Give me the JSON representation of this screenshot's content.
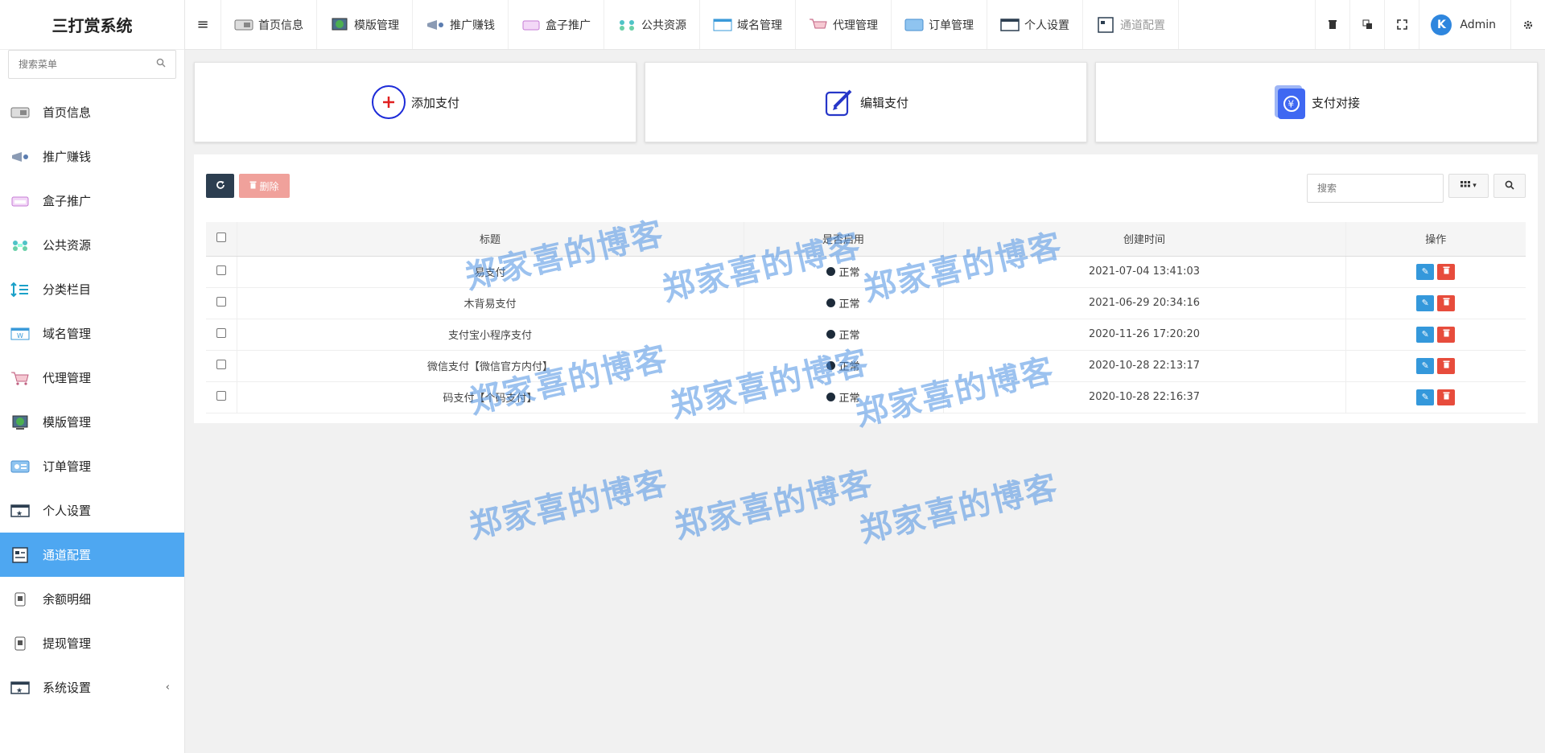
{
  "brand": "三打赏系统",
  "sidebar": {
    "search_placeholder": "搜索菜单",
    "items": [
      {
        "label": "首页信息",
        "icon": "home-card-icon"
      },
      {
        "label": "推广赚钱",
        "icon": "megaphone-icon"
      },
      {
        "label": "盒子推广",
        "icon": "box-icon"
      },
      {
        "label": "公共资源",
        "icon": "resource-icon"
      },
      {
        "label": "分类栏目",
        "icon": "sort-icon"
      },
      {
        "label": "域名管理",
        "icon": "domain-icon"
      },
      {
        "label": "代理管理",
        "icon": "cart-icon"
      },
      {
        "label": "模版管理",
        "icon": "template-icon"
      },
      {
        "label": "订单管理",
        "icon": "order-icon"
      },
      {
        "label": "个人设置",
        "icon": "profile-icon"
      },
      {
        "label": "通道配置",
        "icon": "channel-icon"
      },
      {
        "label": "余额明细",
        "icon": "balance-icon"
      },
      {
        "label": "提现管理",
        "icon": "withdraw-icon"
      },
      {
        "label": "系统设置",
        "icon": "settings-icon"
      }
    ],
    "active_index": 10
  },
  "topbar": {
    "tabs": [
      {
        "label": "首页信息"
      },
      {
        "label": "模版管理"
      },
      {
        "label": "推广赚钱"
      },
      {
        "label": "盒子推广"
      },
      {
        "label": "公共资源"
      },
      {
        "label": "域名管理"
      },
      {
        "label": "代理管理"
      },
      {
        "label": "订单管理"
      },
      {
        "label": "个人设置"
      },
      {
        "label": "通道配置"
      }
    ],
    "user": "Admin"
  },
  "cards": {
    "add": "添加支付",
    "edit": "编辑支付",
    "connect": "支付对接"
  },
  "toolbar": {
    "delete_label": "删除",
    "search_placeholder": "搜索"
  },
  "table": {
    "headers": [
      "标题",
      "是否启用",
      "创建时间",
      "操作"
    ],
    "rows": [
      {
        "title": "易支付",
        "status": "正常",
        "created": "2021-07-04 13:41:03"
      },
      {
        "title": "木背易支付",
        "status": "正常",
        "created": "2021-06-29 20:34:16"
      },
      {
        "title": "支付宝小程序支付",
        "status": "正常",
        "created": "2020-11-26 17:20:20"
      },
      {
        "title": "微信支付【微信官方内付】",
        "status": "正常",
        "created": "2020-10-28 22:13:17"
      },
      {
        "title": "码支付【个码支付】",
        "status": "正常",
        "created": "2020-10-28 22:16:37"
      }
    ]
  },
  "watermark": "郑家喜的博客",
  "colors": {
    "active": "#4ea7f1",
    "edit": "#3498db",
    "delete": "#e74c3c",
    "refresh": "#2c3e50"
  }
}
